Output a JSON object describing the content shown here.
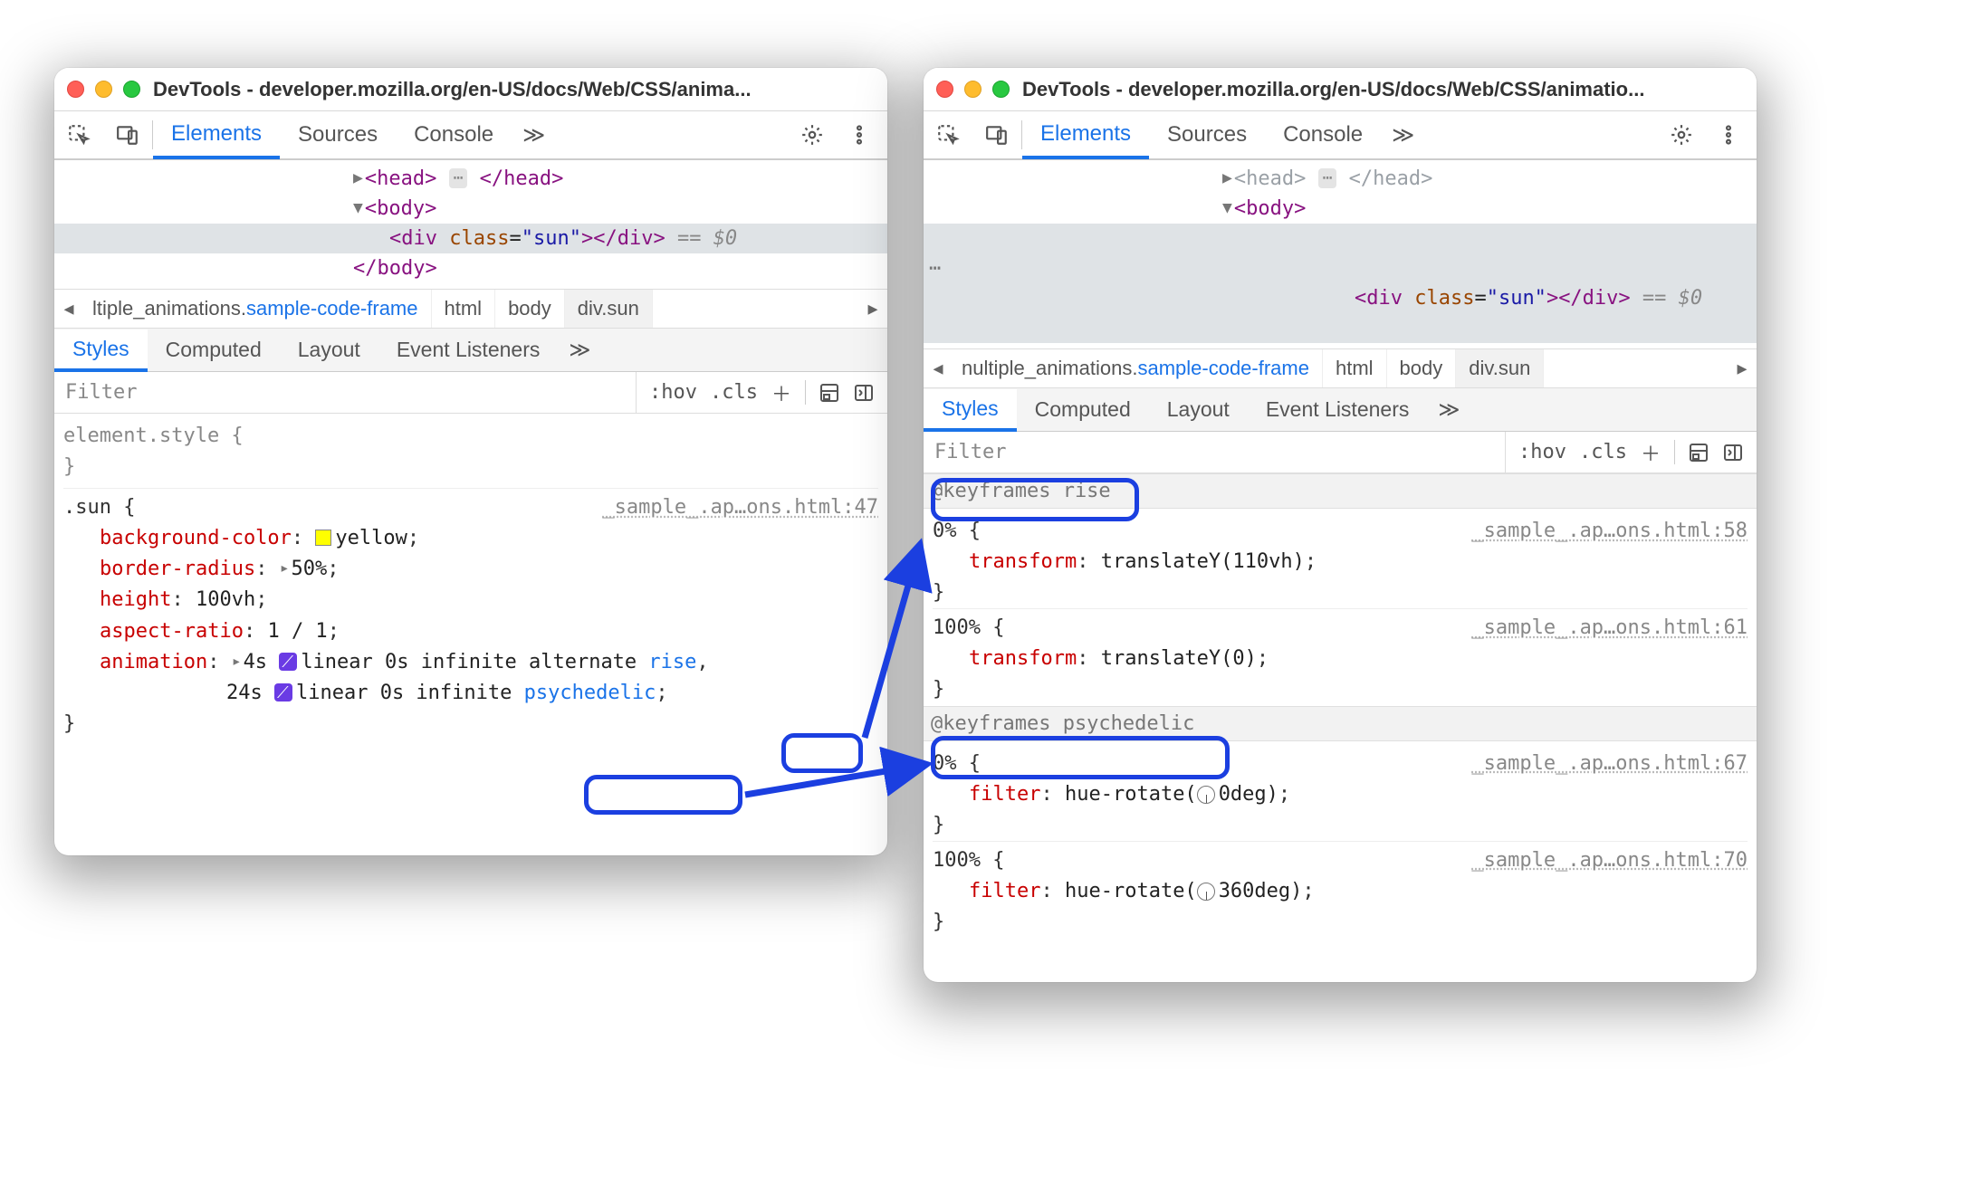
{
  "left": {
    "title": "DevTools - developer.mozilla.org/en-US/docs/Web/CSS/anima...",
    "tabs": {
      "elements": "Elements",
      "sources": "Sources",
      "console": "Console"
    },
    "dom": {
      "head_open": "<head>",
      "head_close": "</head>",
      "body_open": "<body>",
      "body_close": "</body>",
      "div_open_tag": "div",
      "div_attr": "class",
      "div_val": "\"sun\"",
      "div_close": "</div>",
      "eq0": "== $0"
    },
    "breadcrumb": {
      "frame": "ltiple_animations.",
      "frame_link": "sample-code-frame",
      "items": [
        "html",
        "body",
        "div.sun"
      ]
    },
    "subtabs": {
      "styles": "Styles",
      "computed": "Computed",
      "layout": "Layout",
      "listeners": "Event Listeners"
    },
    "filter": {
      "placeholder": "Filter",
      "hov": ":hov",
      "cls": ".cls"
    },
    "css": {
      "elem_style": "element.style {",
      "close": "}",
      "sun_selector": ".sun {",
      "sun_src": "_sample_.ap…ons.html:47",
      "props": {
        "bg": {
          "k": "background-color",
          "v": "yellow"
        },
        "br": {
          "k": "border-radius",
          "v": "50%"
        },
        "h": {
          "k": "height",
          "v": "100vh"
        },
        "ar": {
          "k": "aspect-ratio",
          "v": "1 / 1"
        },
        "anim": {
          "k": "animation",
          "line1_pre": "4s ",
          "line1_mid": "linear 0s infinite alternate ",
          "rise": "rise",
          "line2_pre": "24s ",
          "line2_mid": "linear 0s infinite ",
          "psy": "psychedelic"
        }
      }
    }
  },
  "right": {
    "title": "DevTools - developer.mozilla.org/en-US/docs/Web/CSS/animatio...",
    "tabs": {
      "elements": "Elements",
      "sources": "Sources",
      "console": "Console"
    },
    "dom": {
      "head_open": "<head>",
      "head_close": "</head>",
      "body_open": "<body>",
      "div_open_tag": "div",
      "div_attr": "class",
      "div_val": "\"sun\"",
      "div_close": "</div>",
      "eq0": "== $0"
    },
    "breadcrumb": {
      "frame": "nultiple_animations.",
      "frame_link": "sample-code-frame",
      "items": [
        "html",
        "body",
        "div.sun"
      ]
    },
    "subtabs": {
      "styles": "Styles",
      "computed": "Computed",
      "layout": "Layout",
      "listeners": "Event Listeners"
    },
    "filter": {
      "placeholder": "Filter",
      "hov": ":hov",
      "cls": ".cls"
    },
    "kf": {
      "rise": {
        "header": "@keyframes rise",
        "p0": {
          "src": "_sample_.ap…ons.html:58",
          "sel": "0% {",
          "prop": "transform",
          "val": "translateY(110vh)"
        },
        "p100": {
          "src": "_sample_.ap…ons.html:61",
          "sel": "100% {",
          "prop": "transform",
          "val": "translateY(0)"
        }
      },
      "psy": {
        "header": "@keyframes psychedelic",
        "p0": {
          "src": "_sample_.ap…ons.html:67",
          "sel": "0% {",
          "prop": "filter",
          "fn": "hue-rotate(",
          "val": "0deg",
          "cl": ")"
        },
        "p100": {
          "src": "_sample_.ap…ons.html:70",
          "sel": "100% {",
          "prop": "filter",
          "fn": "hue-rotate(",
          "val": "360deg",
          "cl": ")"
        }
      },
      "close": "}"
    }
  }
}
